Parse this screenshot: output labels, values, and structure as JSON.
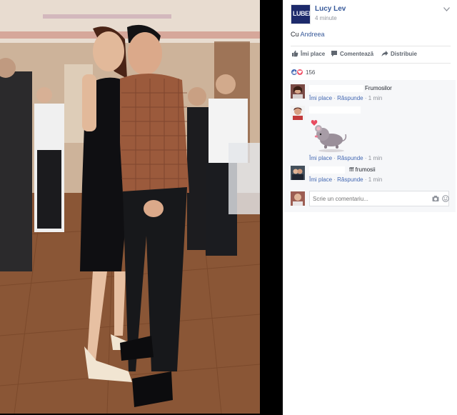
{
  "post": {
    "author": "Lucy Lev",
    "author_logo_text": "LUBED",
    "time": "4 minute",
    "caption_prefix": "Cu",
    "tagged": "Andreea",
    "reaction_count": "156"
  },
  "actions": {
    "like": "Îmi place",
    "comment": "Comentează",
    "share": "Distribuie"
  },
  "comments": [
    {
      "text": "Frumosilor",
      "like": "Îmi place",
      "reply": "Răspunde",
      "time": "1 min"
    },
    {
      "text": "",
      "like": "Îmi place",
      "reply": "Răspunde",
      "time": "1 min"
    },
    {
      "text": "fff frumosii",
      "like": "Îmi place",
      "reply": "Răspunde",
      "time": "1 min"
    }
  ],
  "meta_sep": "·",
  "write_comment": {
    "placeholder": "Scrie un comentariu..."
  },
  "colors": {
    "link": "#365899",
    "like_blue": "#4267b2",
    "love_red": "#f25268",
    "muted": "#90949c"
  },
  "icons": [
    "chevron-down-icon",
    "like-icon",
    "comment-icon",
    "share-icon",
    "camera-icon",
    "emoji-icon"
  ]
}
